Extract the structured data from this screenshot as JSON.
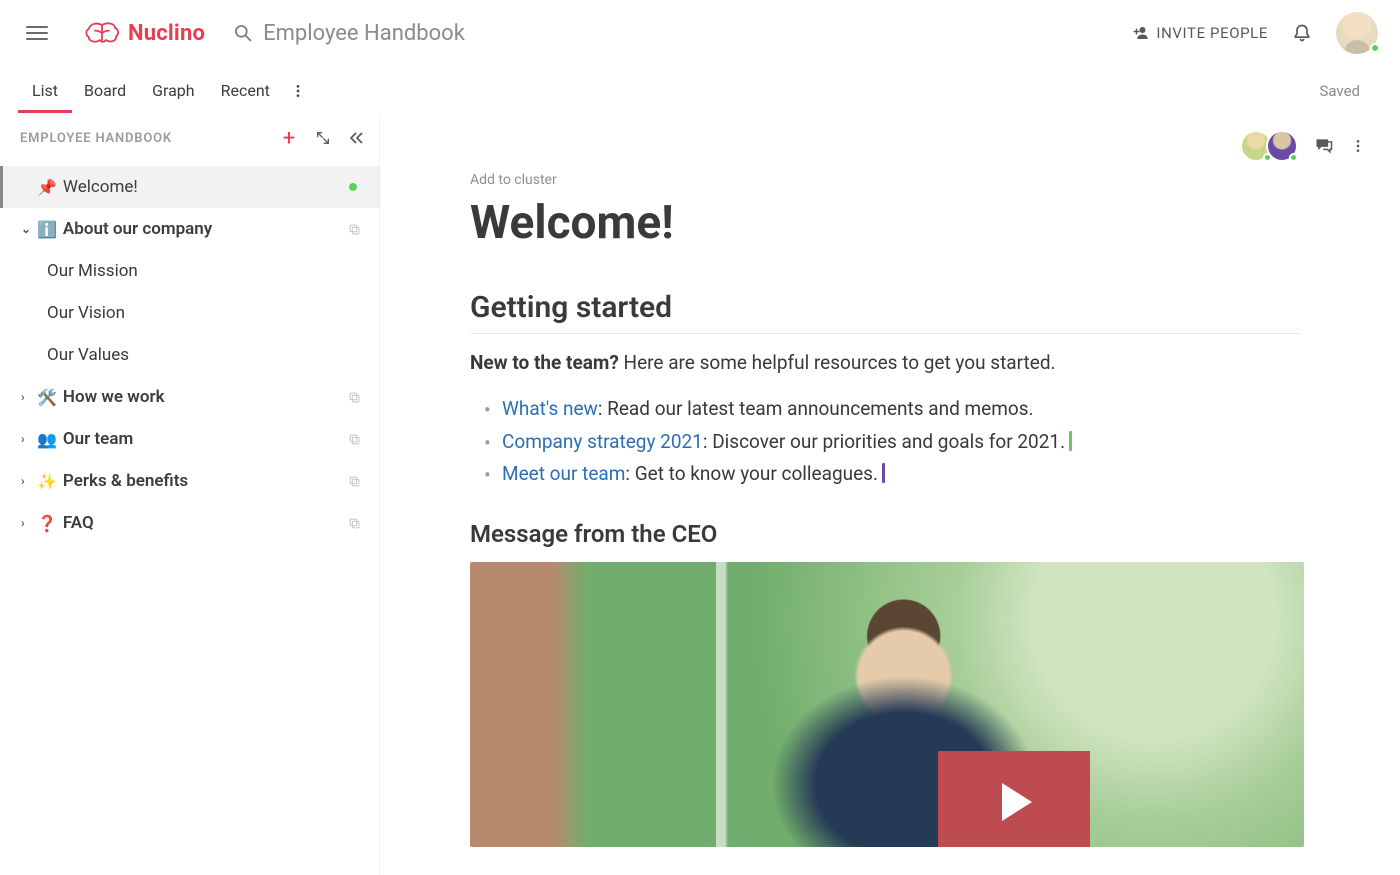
{
  "app": {
    "brand": "Nuclino",
    "search_placeholder": "Employee Handbook",
    "invite_label": "INVITE PEOPLE",
    "saved_label": "Saved"
  },
  "tabs": {
    "items": [
      "List",
      "Board",
      "Graph",
      "Recent"
    ],
    "active_index": 0
  },
  "sidebar": {
    "breadcrumb": "EMPLOYEE HANDBOOK",
    "items": [
      {
        "emoji": "📌",
        "label": "Welcome!",
        "active": true,
        "has_status_dot": true
      },
      {
        "emoji": "ℹ️",
        "label": "About our company",
        "expanded": true,
        "bold": true,
        "children": [
          "Our Mission",
          "Our Vision",
          "Our Values"
        ]
      },
      {
        "emoji": "🛠️",
        "label": "How we work",
        "expanded": false,
        "bold": true
      },
      {
        "emoji": "👥",
        "label": "Our team",
        "expanded": false,
        "bold": true
      },
      {
        "emoji": "✨",
        "label": "Perks & benefits",
        "expanded": false,
        "bold": true
      },
      {
        "emoji": "❓",
        "label": "FAQ",
        "expanded": false,
        "bold": true
      }
    ]
  },
  "doc": {
    "add_cluster": "Add to cluster",
    "title": "Welcome!",
    "section1": "Getting started",
    "intro_bold": "New to the team?",
    "intro_rest": " Here are some helpful resources to get you started.",
    "bullets": [
      {
        "link": "What's new",
        "rest": ": Read our latest team announcements and memos."
      },
      {
        "link": "Company strategy 2021",
        "rest": ": Discover our priorities and goals for 2021.",
        "caret": "green"
      },
      {
        "link": "Meet our team",
        "rest": ": Get to know your colleagues.",
        "caret": "purple"
      }
    ],
    "section2": "Message from the CEO"
  }
}
